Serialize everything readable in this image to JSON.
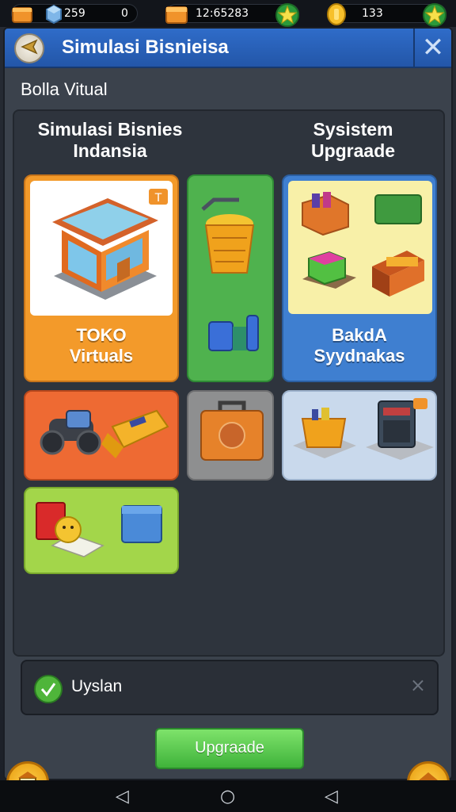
{
  "resources": [
    {
      "icon": "orange-crate-icon",
      "value": "259"
    },
    {
      "icon": "blue-cube-icon",
      "value": "0"
    },
    {
      "icon": "orange-crate-icon",
      "value": "12:65283"
    },
    {
      "icon": "green-star-icon",
      "value": ""
    },
    {
      "icon": "gold-coin-icon",
      "value": "133"
    },
    {
      "icon": "green-star-icon",
      "value": ""
    }
  ],
  "header": {
    "title": "Simulasi Bisnieisa",
    "close": "✕"
  },
  "subtitle": "Bolla Vitual",
  "sections": [
    {
      "title": "Simulasi Bisnies Indansia"
    },
    {
      "title": "Sysistem Upgraade"
    }
  ],
  "cards": [
    {
      "label": "TOKO Virtuals",
      "color": "#f39a2a"
    },
    {
      "label": "",
      "color": "#4fb24e"
    },
    {
      "label": "BakdA Syydnakas",
      "color": "#3f7fd0"
    },
    {
      "label": "",
      "color": "#ee6a33"
    },
    {
      "label": "",
      "color": "#8e8f90"
    },
    {
      "label": "",
      "color": "#c9d9ec"
    },
    {
      "label": "",
      "color": "#a3d64a"
    }
  ],
  "status": {
    "label": "Uyslan",
    "dismiss": "×"
  },
  "upgrade_button": "Upgraade",
  "nav": {
    "back": "◁",
    "home": "○",
    "recent": "◁"
  }
}
